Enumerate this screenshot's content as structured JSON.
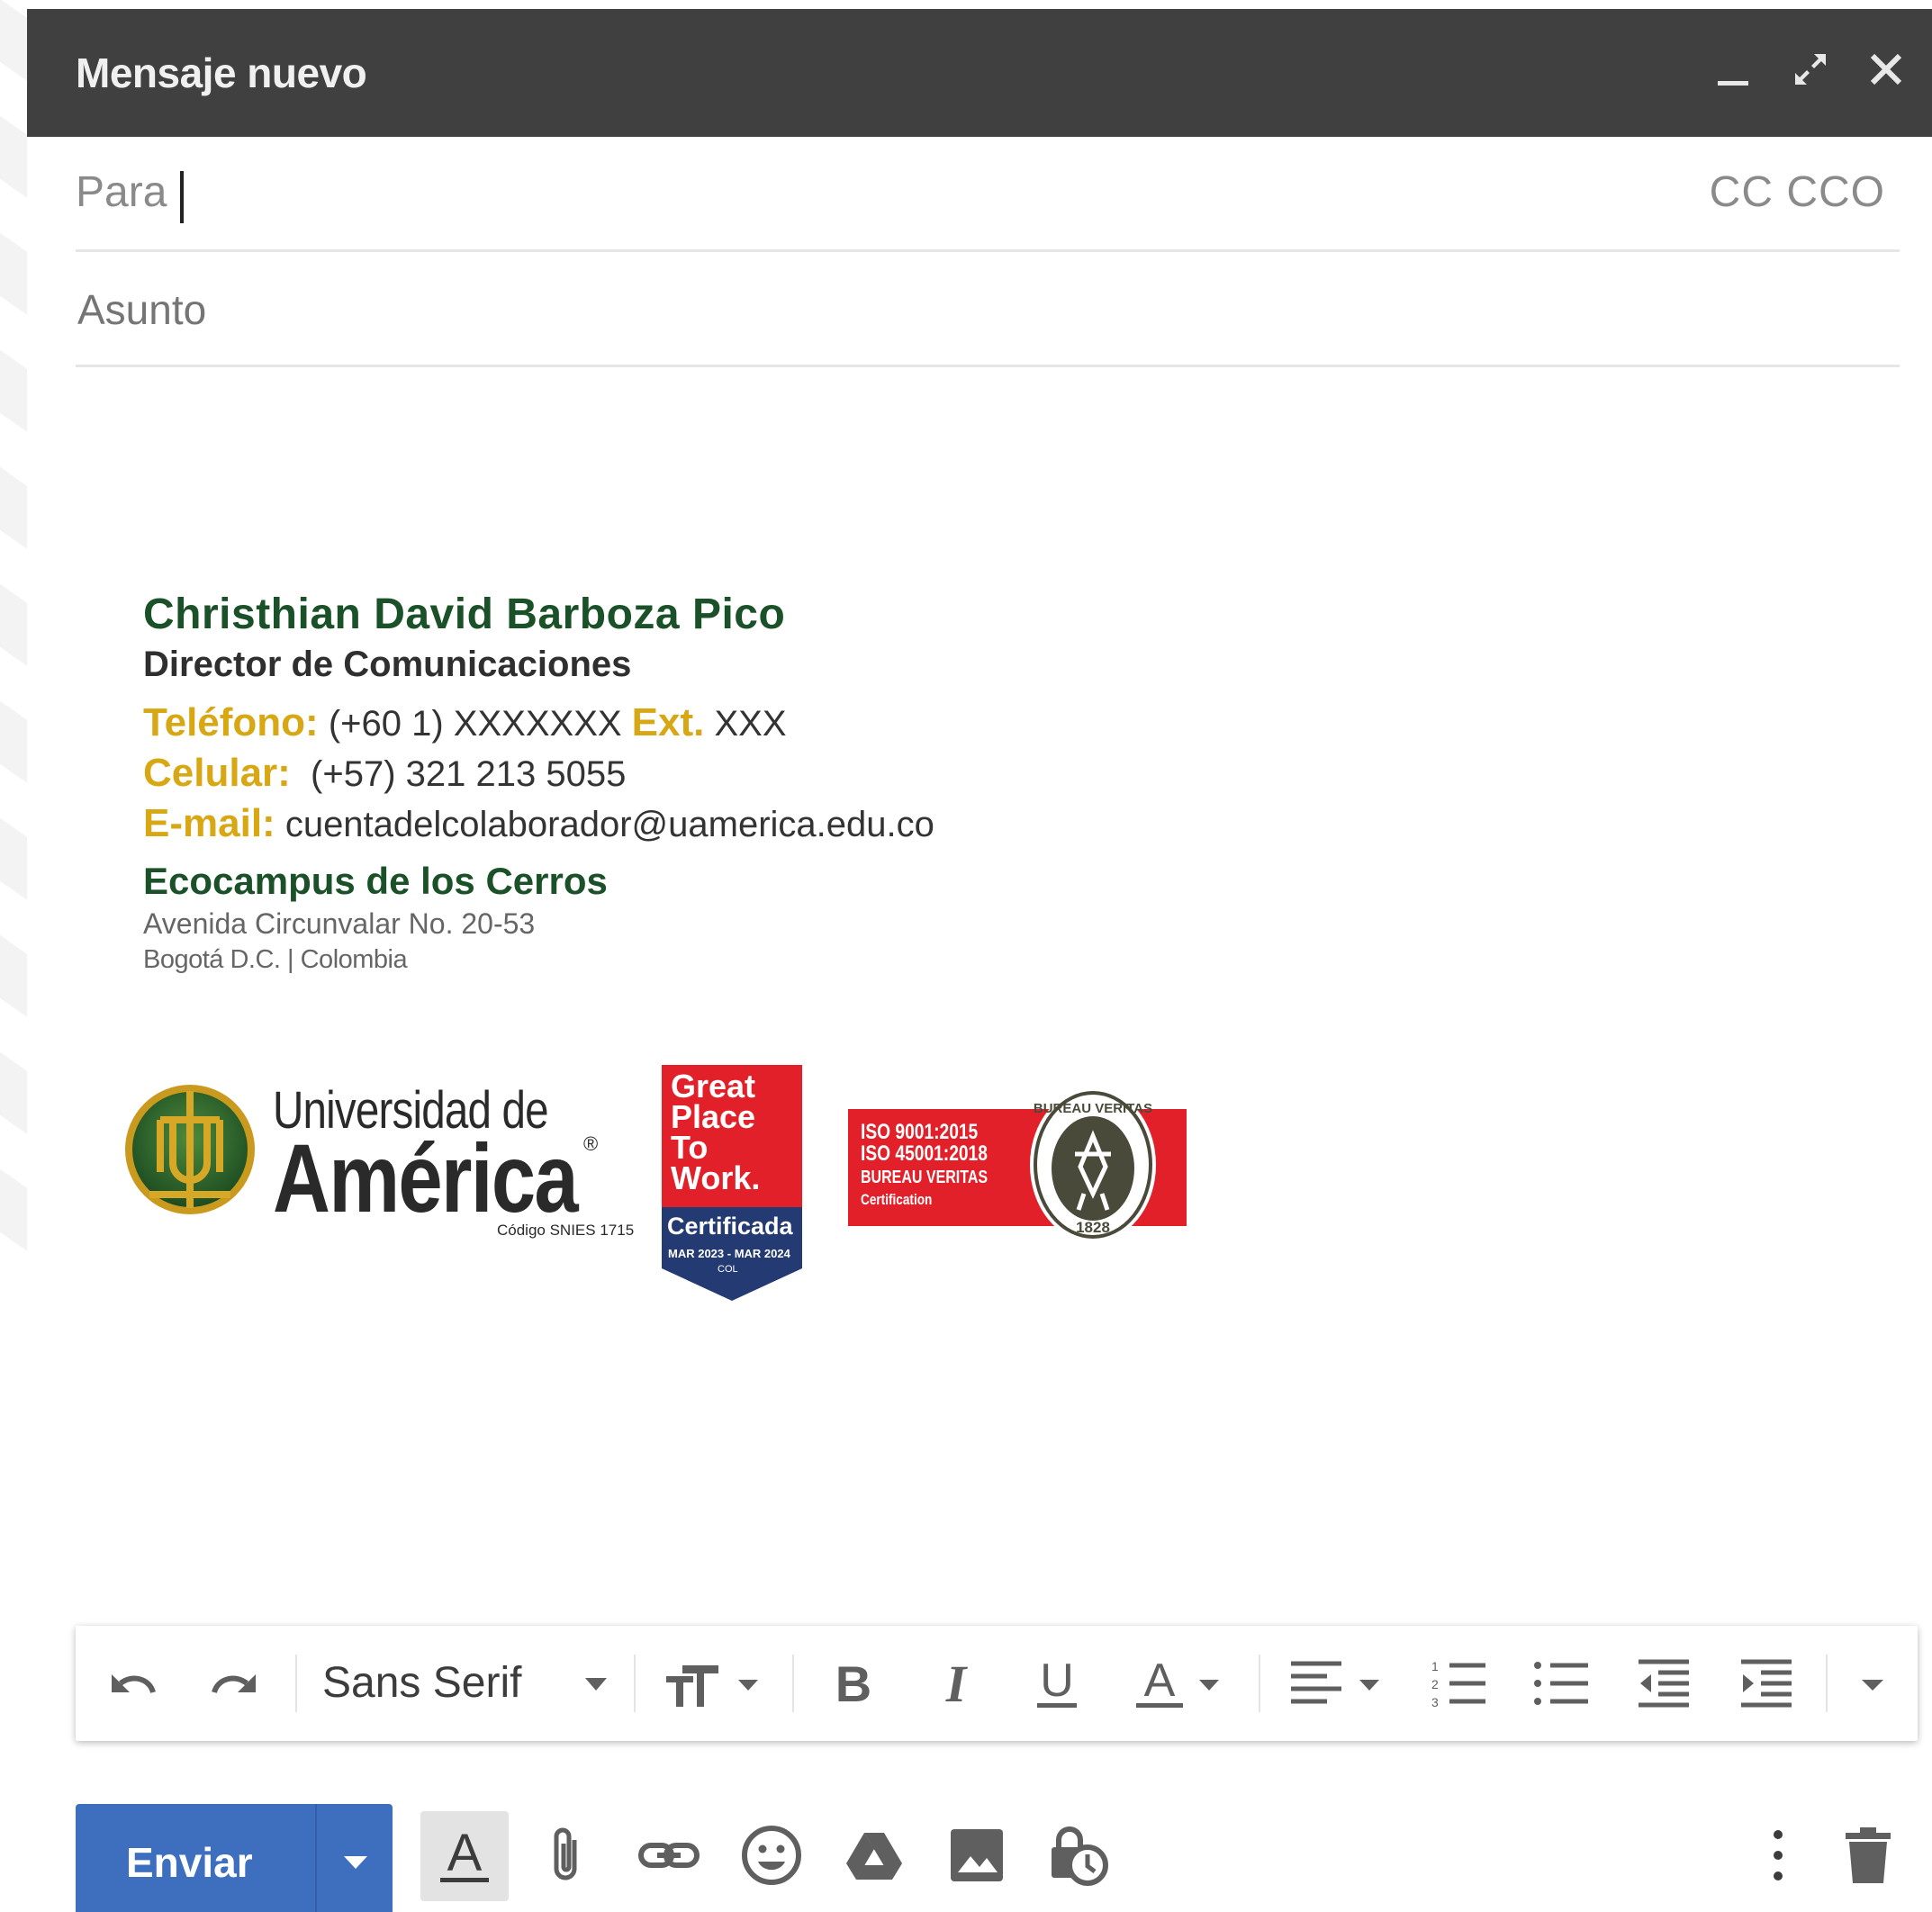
{
  "window": {
    "title": "Mensaje nuevo"
  },
  "header_icons": [
    "minimize-icon",
    "expand-icon",
    "close-icon"
  ],
  "fields": {
    "to_label": "Para",
    "cc_bcc": "CC CCO",
    "subject_placeholder": "Asunto"
  },
  "signature": {
    "name": "Christhian David Barboza Pico",
    "role": "Director de Comunicaciones",
    "phone_label": "Teléfono:",
    "phone_value": " (+60 1) XXXXXXX ",
    "ext_label": "Ext.",
    "ext_value": " XXX",
    "mobile_label": "Celular:",
    "mobile_value": "  (+57) 321 213 5055",
    "email_label": "E-mail:",
    "email_value": " cuentadelcolaborador@uamerica.edu.co",
    "campus": "Ecocampus de los Cerros",
    "address": "Avenida Circunvalar No. 20-53",
    "city": "Bogotá D.C. | Colombia"
  },
  "logos": {
    "university": {
      "line1": "Universidad de",
      "line2": "América",
      "registered": "®",
      "code": "Código SNIES 1715"
    },
    "gptw": {
      "line1": "Great",
      "line2": "Place",
      "line3": "To",
      "line4": "Work.",
      "certified": "Certificada",
      "dates": "MAR 2023 - MAR 2024",
      "country": "COL"
    },
    "bureau_veritas": {
      "iso1": "ISO 9001:2015",
      "iso2": "ISO 45001:2018",
      "name": "BUREAU VERITAS",
      "sub": "Certification",
      "seal_text": "BUREAU VERITAS",
      "seal_year": "1828"
    }
  },
  "format_toolbar": {
    "font": "Sans Serif",
    "icons": [
      "undo-icon",
      "redo-icon",
      "font-dropdown-icon",
      "text-size-icon",
      "bold-icon",
      "italic-icon",
      "underline-icon",
      "text-color-icon",
      "align-icon",
      "numbered-list-icon",
      "bulleted-list-icon",
      "indent-less-icon",
      "indent-more-icon",
      "more-formatting-icon"
    ]
  },
  "bottom_toolbar": {
    "send_label": "Enviar",
    "icons": [
      "send-options-icon",
      "formatting-toggle-icon",
      "attach-icon",
      "link-icon",
      "emoji-icon",
      "drive-icon",
      "photo-icon",
      "confidential-mode-icon",
      "more-options-icon",
      "discard-icon"
    ]
  },
  "colors": {
    "header_bg": "#404040",
    "signature_green": "#1b5128",
    "signature_gold": "#d8a714",
    "send_blue": "#3d6fbe",
    "badge_red": "#e2202a",
    "badge_navy": "#233a72"
  }
}
